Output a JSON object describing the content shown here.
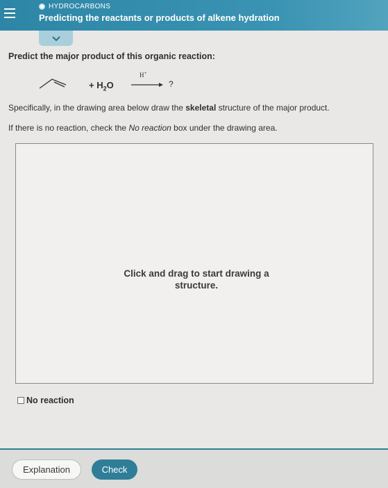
{
  "header": {
    "topic": "HYDROCARBONS",
    "title": "Predicting the reactants or products of alkene hydration"
  },
  "question": {
    "prompt": "Predict the major product of this organic reaction:",
    "reaction": {
      "reagent_plus": "+ H",
      "reagent_sub": "2",
      "reagent_tail": "O",
      "catalyst": "H",
      "catalyst_sup": "+",
      "product": "?"
    },
    "instruction_1": {
      "before": "Specifically, in the drawing area below draw the ",
      "bold": "skeletal",
      "after": " structure of the major product."
    },
    "instruction_2": {
      "before": "If there is no reaction, check the ",
      "italic": "No reaction",
      "after": " box under the drawing area."
    }
  },
  "drawing_area": {
    "hint_line1": "Click and drag to start drawing a",
    "hint_line2": "structure."
  },
  "no_reaction": {
    "label": "No reaction",
    "checked": false
  },
  "footer": {
    "explanation_label": "Explanation",
    "check_label": "Check"
  },
  "colors": {
    "header_teal": "#2e86a6",
    "check_button": "#2f7e98",
    "page_background": "#e9e8e6"
  },
  "icons": [
    "hamburger-menu-icon",
    "topic-status-icon",
    "chevron-down-icon"
  ]
}
